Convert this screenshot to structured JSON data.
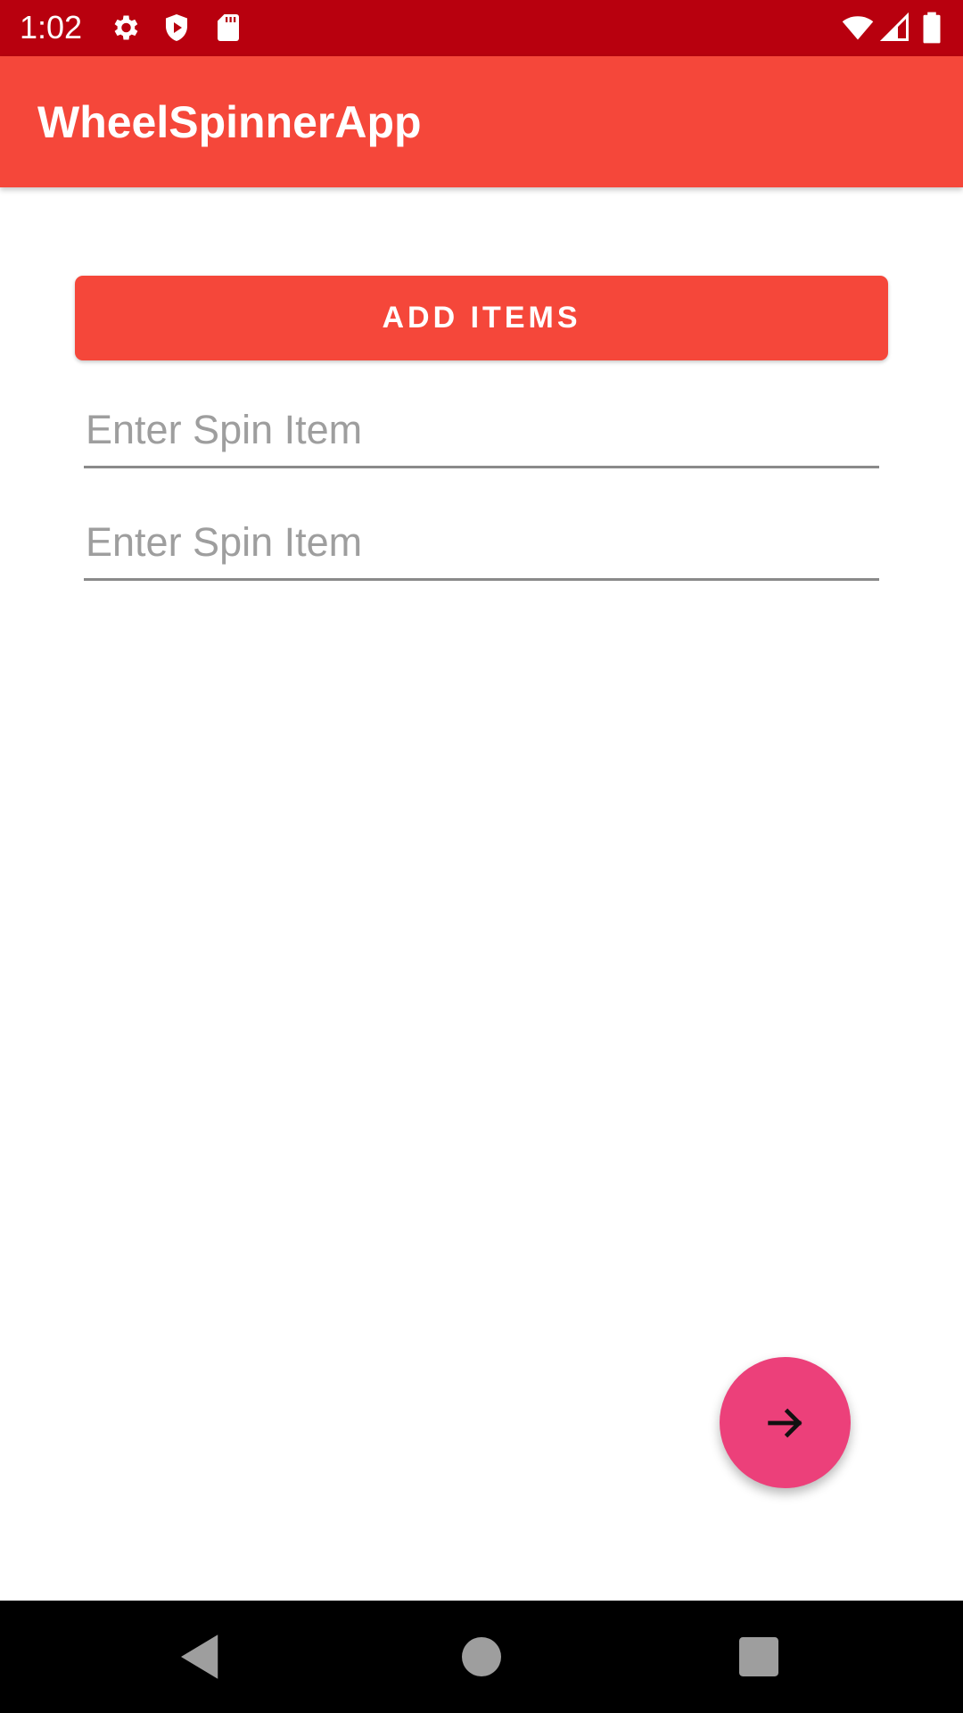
{
  "status_bar": {
    "time": "1:02",
    "left_icons": [
      "settings-icon",
      "shield-play-icon",
      "sd-card-icon"
    ],
    "right_icons": [
      "wifi-icon",
      "cell-signal-icon",
      "battery-icon"
    ],
    "color": "#b8000e"
  },
  "app_bar": {
    "title": "WheelSpinnerApp",
    "color": "#f5473a"
  },
  "main": {
    "add_button_label": "ADD ITEMS",
    "inputs": [
      {
        "value": "",
        "placeholder": "Enter Spin Item"
      },
      {
        "value": "",
        "placeholder": "Enter Spin Item"
      }
    ]
  },
  "fab": {
    "icon": "arrow-right-icon",
    "color": "#ec407a"
  },
  "nav_bar": {
    "buttons": [
      "back-icon",
      "home-icon",
      "recents-icon"
    ]
  }
}
